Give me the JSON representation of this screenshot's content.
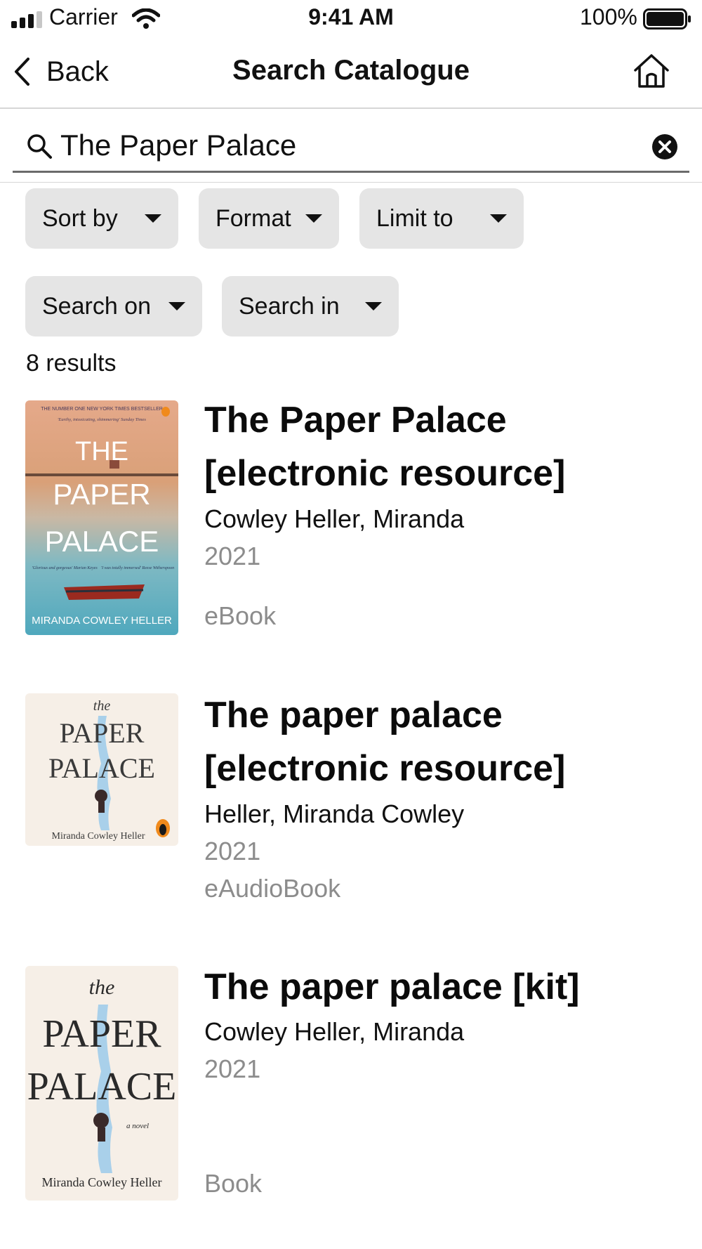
{
  "status_bar": {
    "carrier": "Carrier",
    "time": "9:41 AM",
    "battery": "100%"
  },
  "nav": {
    "back_label": "Back",
    "title": "Search Catalogue",
    "home_icon": "home-icon"
  },
  "search": {
    "value": "The Paper Palace",
    "search_icon": "search-icon",
    "clear_icon": "clear-icon"
  },
  "filters": {
    "sort_by": "Sort by",
    "format": "Format",
    "limit_to": "Limit to",
    "search_on": "Search on",
    "search_in": "Search in"
  },
  "results_count": "8 results",
  "results": [
    {
      "title_line1": "The Paper Palace",
      "title_line2": "[electronic resource]",
      "author": "Cowley Heller, Miranda",
      "year": "2021",
      "format": "eBook",
      "cover": {
        "top_banner": "THE NUMBER ONE NEW YORK TIMES BESTSELLER",
        "quote": "'Earthy, intoxicating, shimmering' Sunday Times",
        "line1": "THE",
        "line2": "PAPER",
        "line3": "PALACE",
        "quote_left": "'Glorious and gorgeous' Marian Keyes",
        "quote_right": "'I was totally immersed' Reese Witherspoon",
        "author": "MIRANDA COWLEY HELLER"
      }
    },
    {
      "title_line1": "The paper palace",
      "title_line2": "[electronic resource]",
      "author": "Heller, Miranda Cowley",
      "year": "2021",
      "format": "eAudioBook",
      "cover": {
        "the": "the",
        "line1": "PAPER",
        "line2": "PALACE",
        "author": "Miranda Cowley Heller"
      }
    },
    {
      "title_line1": "The paper palace [kit]",
      "author": "Cowley Heller, Miranda",
      "year": "2021",
      "format": "Book",
      "cover": {
        "the": "the",
        "line1": "PAPER",
        "line2": "PALACE",
        "tag": "a novel",
        "author": "Miranda Cowley Heller"
      }
    }
  ],
  "colors": {
    "chip_bg": "#e5e5e5",
    "muted_text": "#8c8c8c",
    "divider": "#d6d6d6"
  }
}
